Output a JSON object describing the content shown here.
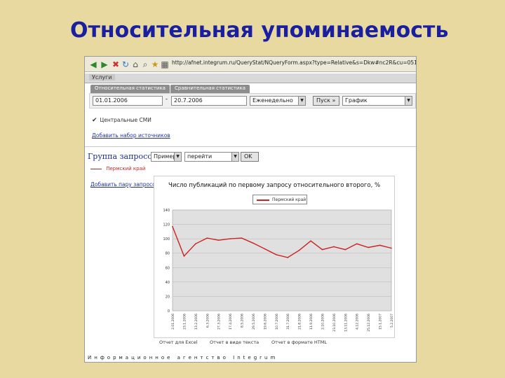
{
  "slide": {
    "title": "Относительная упоминаемость"
  },
  "browser": {
    "url": "http://afnet.integrum.ru/QueryStat/NQueryForm.aspx?type=Relative&s=Dkw#nc2R&cu=0518omen",
    "icons": [
      "back-icon",
      "forward-icon",
      "stop-icon",
      "refresh-icon",
      "home-icon",
      "search-icon",
      "favorites-icon",
      "history-icon",
      "mail-icon",
      "print-icon",
      "address-icon"
    ]
  },
  "menu": {
    "services_label": "Услуги"
  },
  "tabs": [
    {
      "label": "Относительная статистика"
    },
    {
      "label": "Сравнительная статистика"
    }
  ],
  "form": {
    "date_from": "01.01.2006",
    "dash": "-",
    "date_to": "20.7.2006",
    "period": "Еженедельно",
    "start_button": "Пуск »",
    "view_type": "График"
  },
  "checkbox": {
    "label": "Центральные СМИ",
    "checked": true
  },
  "links": {
    "add_source_set": "Добавить набор источников",
    "add_query_pair": "Добавить пару запросов"
  },
  "query_group": {
    "label": "Группа запросов:",
    "example_value": "Пример",
    "goto_value": "перейти",
    "ok_button": "OK",
    "legend_item": "Пермский край"
  },
  "chart_data": {
    "type": "line",
    "title": "Число публикаций по первому запросу относительного второго, %",
    "series": [
      {
        "name": "Пермский край",
        "color": "#cc2222",
        "values": [
          117,
          76,
          93,
          101,
          98,
          100,
          101,
          94,
          86,
          78,
          74,
          84,
          97,
          85,
          89,
          85,
          93,
          88,
          91,
          87
        ]
      }
    ],
    "x": [
      "2.01.2006",
      "23.1.2006",
      "13.2.2006",
      "6.3.2006",
      "27.3.2006",
      "17.4.2006",
      "8.5.2006",
      "29.5.2006",
      "19.6.2006",
      "10.7.2006",
      "31.7.2006",
      "21.8.2006",
      "11.9.2006",
      "2.10.2006",
      "23.10.2006",
      "13.11.2006",
      "4.12.2006",
      "25.12.2006",
      "15.1.2007",
      "5.2.2007"
    ],
    "yticks": [
      0,
      20,
      40,
      60,
      80,
      100,
      120,
      140
    ],
    "ylim": [
      0,
      140
    ],
    "grid": true,
    "plot_bg": "#e0e0e0"
  },
  "bottom_links": [
    {
      "label": "Отчет для Excel"
    },
    {
      "label": "Отчет в виде текста"
    },
    {
      "label": "Отчет в формате HTML"
    }
  ],
  "footer": {
    "text": "Информационное агентство Integrum"
  },
  "colors": {
    "slide_bg": "#e8d9a0",
    "title": "#1a1fa0",
    "line": "#cc2222",
    "link": "#2233aa"
  }
}
